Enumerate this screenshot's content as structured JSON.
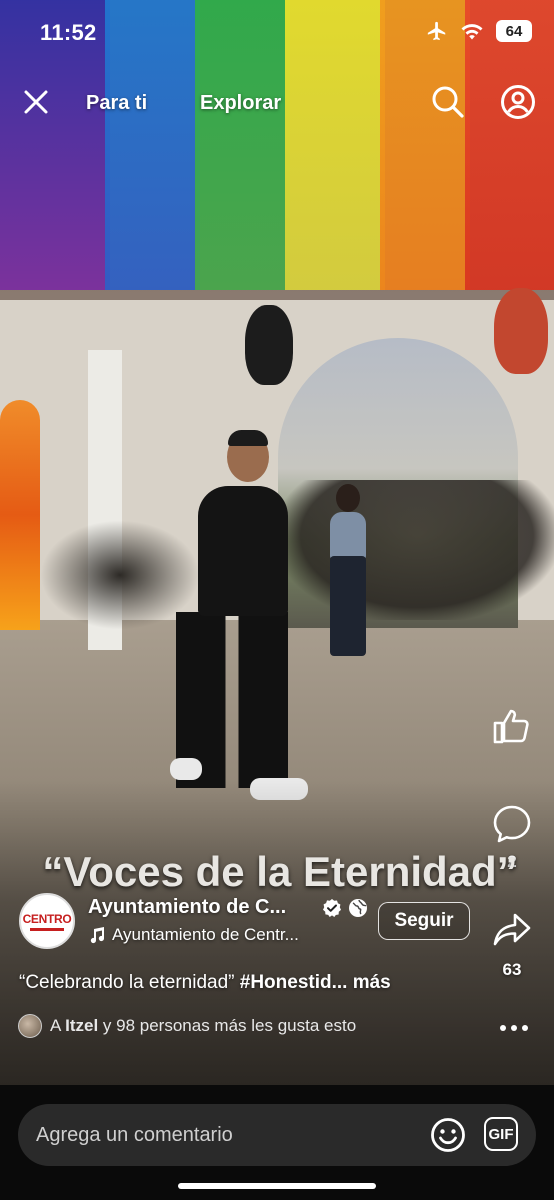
{
  "status_bar": {
    "time": "11:52",
    "battery": "64",
    "icons": [
      "airplane-icon",
      "wifi-icon",
      "battery-icon"
    ]
  },
  "top_nav": {
    "tabs": [
      {
        "label": "Para ti"
      },
      {
        "label": "Explorar"
      }
    ],
    "icons": [
      "close-icon",
      "search-icon",
      "profile-icon"
    ]
  },
  "video": {
    "overlay_text": "“Voces de la Eternidad”"
  },
  "author": {
    "name": "Ayuntamiento de C...",
    "avatar_text": "CENTRO",
    "follow_label": "Seguir",
    "audio": "Ayuntamiento de Centr..."
  },
  "actions": {
    "comments_count": "2",
    "shares_count": "63"
  },
  "post": {
    "caption_text": "“Celebrando la eternidad” ",
    "caption_hashtag": "#Honestid...",
    "caption_more": " más",
    "likes_prefix": "A ",
    "likes_user": "Itzel",
    "likes_suffix": " y 98 personas más les gusta esto"
  },
  "comment": {
    "placeholder": "Agrega un comentario",
    "gif_label": "GIF"
  },
  "colors": {
    "background": "#000000",
    "comment_bar": "#2a2a2a",
    "text": "#ffffff",
    "brand_red": "#c61f1f"
  }
}
